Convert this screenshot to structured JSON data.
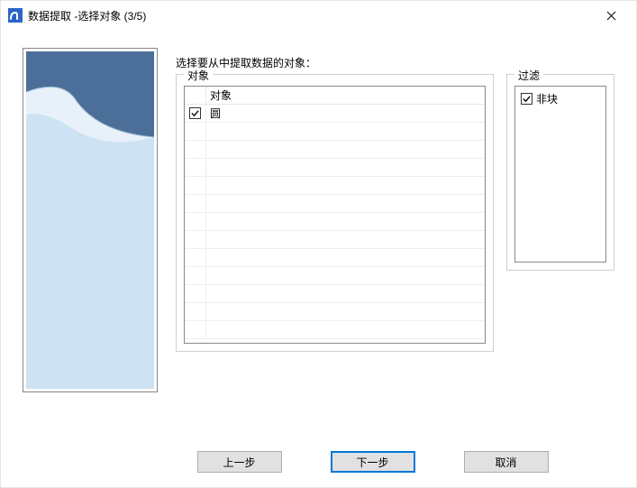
{
  "window": {
    "title": "数据提取 -选择对象 (3/5)"
  },
  "instruction": "选择要从中提取数据的对象：",
  "objects_group": {
    "legend": "对象",
    "header": "对象",
    "rows": [
      {
        "label": "圆",
        "checked": true
      }
    ]
  },
  "filter_group": {
    "legend": "过滤",
    "items": [
      {
        "label": "非块",
        "checked": true
      }
    ]
  },
  "buttons": {
    "back": "上一步",
    "next": "下一步",
    "cancel": "取消"
  }
}
